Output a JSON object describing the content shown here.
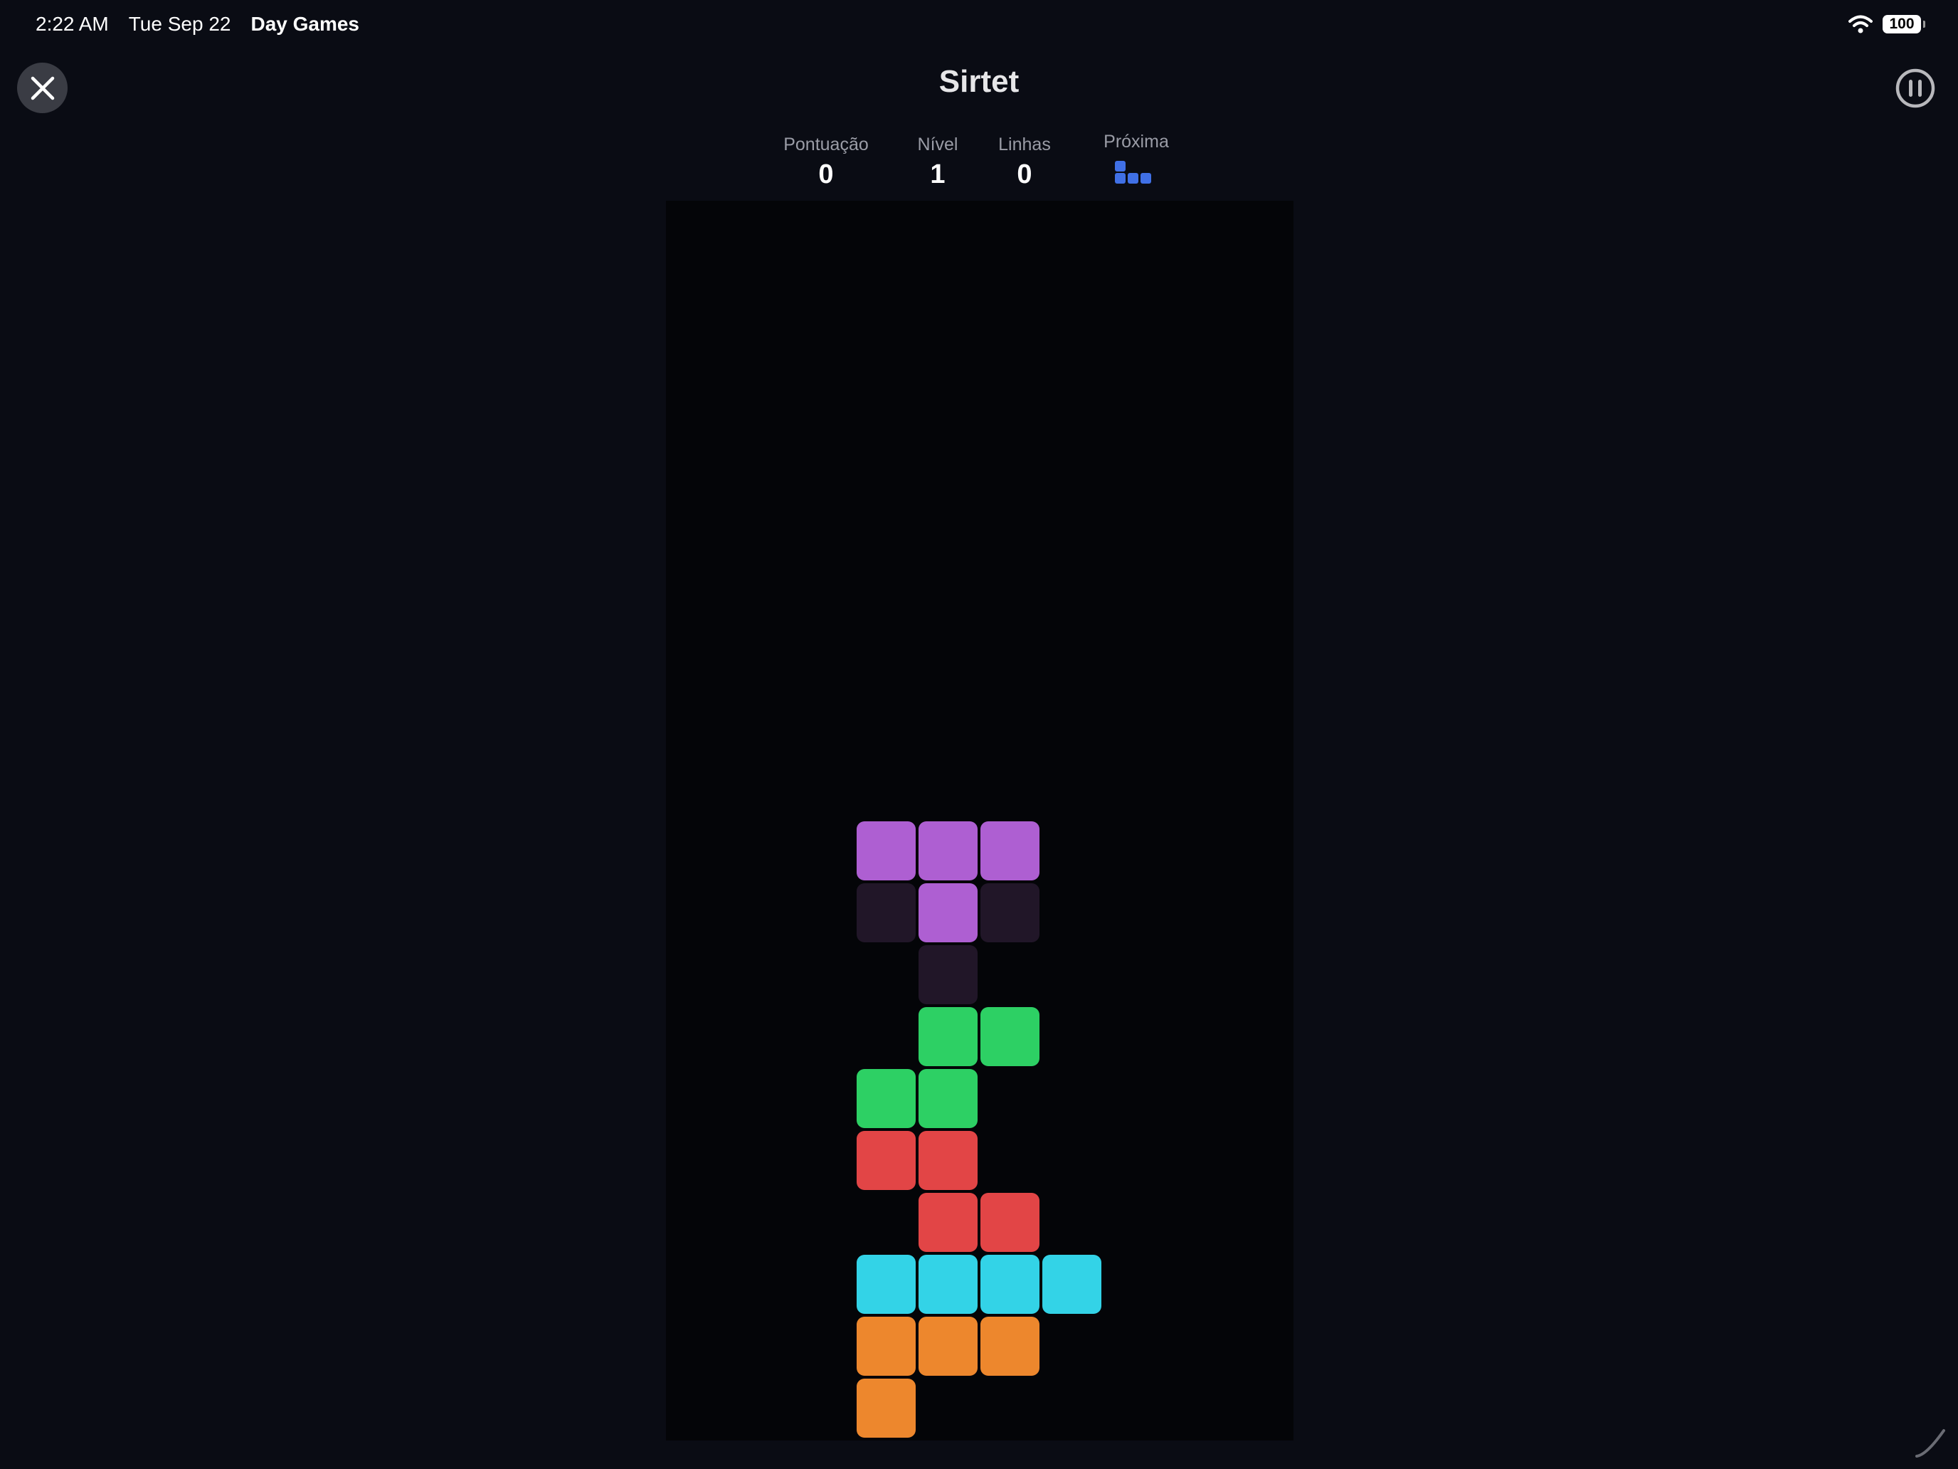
{
  "status_bar": {
    "time": "2:22 AM",
    "date": "Tue Sep 22",
    "app_name": "Day Games",
    "battery": "100",
    "wifi_icon": "wifi-icon"
  },
  "header": {
    "title": "Sirtet",
    "close_icon": "close-icon",
    "pause_icon": "pause-icon"
  },
  "stats": {
    "score_label": "Pontuação",
    "score_value": "0",
    "level_label": "Nível",
    "level_value": "1",
    "lines_label": "Linhas",
    "lines_value": "0",
    "next_label": "Próxima",
    "next_piece": "J",
    "next_piece_color": "#4070e6"
  },
  "board": {
    "columns": 10,
    "rows": 20,
    "colors": {
      "purple": "#ae5fd2",
      "green": "#2dd064",
      "red": "#e24546",
      "cyan": "#33d3e7",
      "orange": "#ed872d",
      "ghost": "#211628"
    },
    "active_piece": {
      "type": "T",
      "color": "purple"
    },
    "ghost_piece": {
      "type": "T",
      "color": "ghost"
    },
    "stacked_pieces": [
      {
        "type": "S",
        "color": "green"
      },
      {
        "type": "Z",
        "color": "red"
      },
      {
        "type": "I",
        "color": "cyan"
      },
      {
        "type": "L",
        "color": "orange"
      }
    ]
  }
}
